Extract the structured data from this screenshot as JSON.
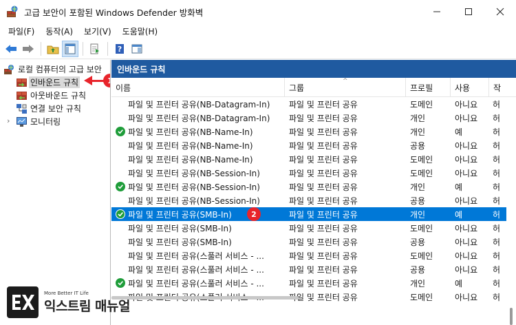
{
  "window": {
    "title": "고급 보안이 포함된 Windows Defender 방화벽"
  },
  "menu": [
    "파일(F)",
    "동작(A)",
    "보기(V)",
    "도움말(H)"
  ],
  "tree": {
    "root": "로컬 컴퓨터의 고급 보안",
    "items": [
      {
        "label": "인바운드 규칙",
        "selected": true
      },
      {
        "label": "아웃바운드 규칙",
        "selected": false
      },
      {
        "label": "연결 보안 규칙",
        "selected": false
      },
      {
        "label": "모니터링",
        "selected": false
      }
    ]
  },
  "panel": {
    "title": "인바운드 규칙",
    "columns": [
      "이름",
      "그룹",
      "프로필",
      "사용",
      "작"
    ]
  },
  "rows": [
    {
      "name": "파일 및 프린터 공유(NB-Datagram-In)",
      "group": "파일 및 프린터 공유",
      "profile": "도메인",
      "enabled": "아니요",
      "action": "허",
      "check": false,
      "selected": false
    },
    {
      "name": "파일 및 프린터 공유(NB-Datagram-In)",
      "group": "파일 및 프린터 공유",
      "profile": "개인",
      "enabled": "아니요",
      "action": "허",
      "check": false,
      "selected": false
    },
    {
      "name": "파일 및 프린터 공유(NB-Name-In)",
      "group": "파일 및 프린터 공유",
      "profile": "개인",
      "enabled": "예",
      "action": "허",
      "check": true,
      "selected": false
    },
    {
      "name": "파일 및 프린터 공유(NB-Name-In)",
      "group": "파일 및 프린터 공유",
      "profile": "공용",
      "enabled": "아니요",
      "action": "허",
      "check": false,
      "selected": false
    },
    {
      "name": "파일 및 프린터 공유(NB-Name-In)",
      "group": "파일 및 프린터 공유",
      "profile": "도메인",
      "enabled": "아니요",
      "action": "허",
      "check": false,
      "selected": false
    },
    {
      "name": "파일 및 프린터 공유(NB-Session-In)",
      "group": "파일 및 프린터 공유",
      "profile": "도메인",
      "enabled": "아니요",
      "action": "허",
      "check": false,
      "selected": false
    },
    {
      "name": "파일 및 프린터 공유(NB-Session-In)",
      "group": "파일 및 프린터 공유",
      "profile": "개인",
      "enabled": "예",
      "action": "허",
      "check": true,
      "selected": false
    },
    {
      "name": "파일 및 프린터 공유(NB-Session-In)",
      "group": "파일 및 프린터 공유",
      "profile": "공용",
      "enabled": "아니요",
      "action": "허",
      "check": false,
      "selected": false
    },
    {
      "name": "파일 및 프린터 공유(SMB-In)",
      "group": "파일 및 프린터 공유",
      "profile": "개인",
      "enabled": "예",
      "action": "허",
      "check": true,
      "selected": true
    },
    {
      "name": "파일 및 프린터 공유(SMB-In)",
      "group": "파일 및 프린터 공유",
      "profile": "도메인",
      "enabled": "아니요",
      "action": "허",
      "check": false,
      "selected": false
    },
    {
      "name": "파일 및 프린터 공유(SMB-In)",
      "group": "파일 및 프린터 공유",
      "profile": "공용",
      "enabled": "아니요",
      "action": "허",
      "check": false,
      "selected": false
    },
    {
      "name": "파일 및 프린터 공유(스풀러 서비스 - ...",
      "group": "파일 및 프린터 공유",
      "profile": "도메인",
      "enabled": "아니요",
      "action": "허",
      "check": false,
      "selected": false
    },
    {
      "name": "파일 및 프린터 공유(스풀러 서비스 - ...",
      "group": "파일 및 프린터 공유",
      "profile": "공용",
      "enabled": "아니요",
      "action": "허",
      "check": false,
      "selected": false
    },
    {
      "name": "파일 및 프린터 공유(스풀러 서비스 - ...",
      "group": "파일 및 프린터 공유",
      "profile": "개인",
      "enabled": "예",
      "action": "허",
      "check": true,
      "selected": false
    },
    {
      "name": "파일 및 프린터 공유(스풀러 서비스 - ...",
      "group": "파일 및 프린터 공유",
      "profile": "도메인",
      "enabled": "아니요",
      "action": "허",
      "check": false,
      "selected": false
    }
  ],
  "callouts": [
    "1",
    "2"
  ],
  "watermark": {
    "tagline": "More Better IT Life",
    "name": "익스트림 매뉴얼"
  },
  "colors": {
    "panel_header": "#1f5aa0",
    "selection": "#0078d7",
    "callout": "#e8242b",
    "check": "#1f9d3a"
  }
}
